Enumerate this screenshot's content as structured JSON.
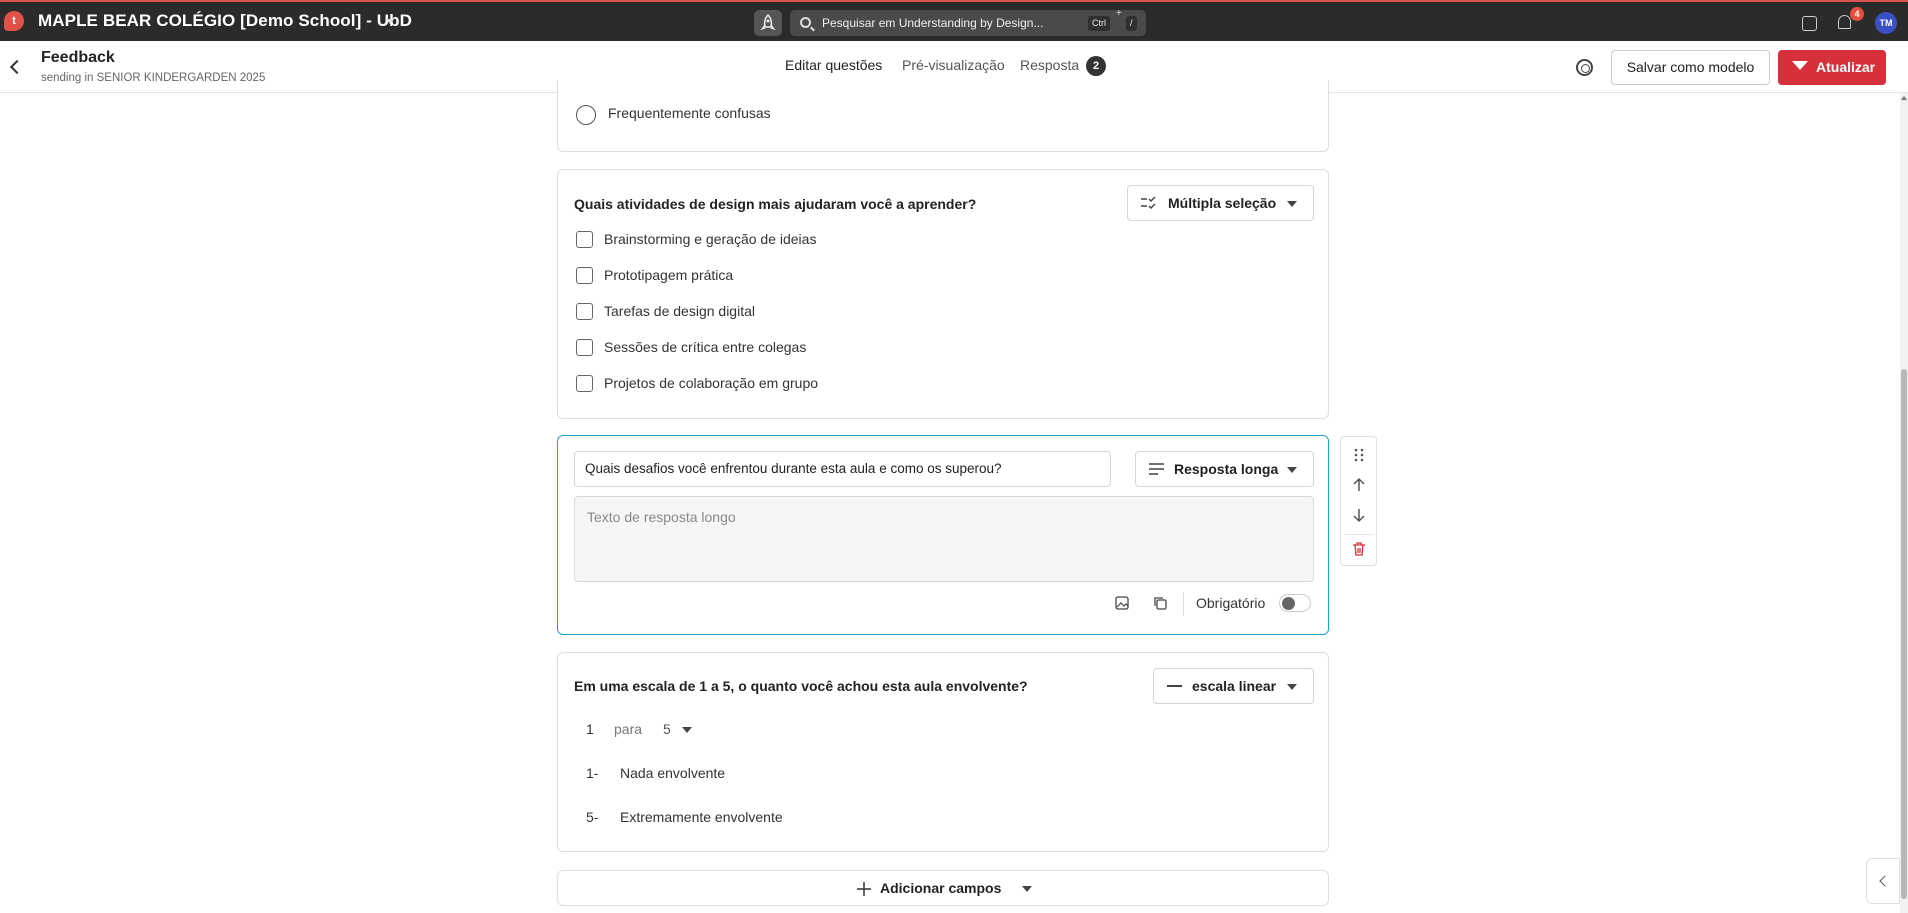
{
  "app": {
    "logo_letter": "t",
    "school_name": "MAPLE BEAR COLÉGIO [Demo School] - UbD",
    "search_placeholder": "Pesquisar em Understanding by Design...",
    "shortcut_ctrl": "Ctrl",
    "shortcut_plus": "+",
    "shortcut_key": "/",
    "notification_count": "4",
    "avatar_initials": "TM"
  },
  "header": {
    "title": "Feedback",
    "subtitle": "sending in SENIOR KINDERGARDEN 2025",
    "tabs": [
      {
        "label": "Editar questões"
      },
      {
        "label": "Pré-visualização"
      },
      {
        "label": "Resposta"
      }
    ],
    "response_count": "2",
    "save_template_label": "Salvar como modelo",
    "update_label": "Atualizar"
  },
  "question_prev": {
    "option_label": "Frequentemente confusas"
  },
  "question_multi": {
    "title": "Quais atividades de design mais ajudaram você a aprender?",
    "type_label": "Múltipla seleção",
    "options": [
      "Brainstorming e geração de ideias",
      "Prototipagem prática",
      "Tarefas de design digital",
      "Sessões de crítica entre colegas",
      "Projetos de colaboração em grupo"
    ]
  },
  "question_long": {
    "title_value": "Quais desafios você enfrentou durante esta aula e como os superou?",
    "type_label": "Resposta longa",
    "answer_placeholder": "Texto de resposta longo",
    "required_label": "Obrigatório",
    "required": false
  },
  "question_scale": {
    "title": "Em uma escala de 1 a 5, o quanto você achou esta aula envolvente?",
    "type_label": "escala linear",
    "min": "1",
    "connector": "para",
    "max": "5",
    "min_prefix": "1-",
    "min_label": "Nada envolvente",
    "max_prefix": "5-",
    "max_label": "Extremamente envolvente"
  },
  "footer": {
    "add_fields_label": "Adicionar campos"
  },
  "colors": {
    "topbar": "#2b2b2b",
    "primary": "#d6313b",
    "active_border": "#1aa3c8"
  }
}
